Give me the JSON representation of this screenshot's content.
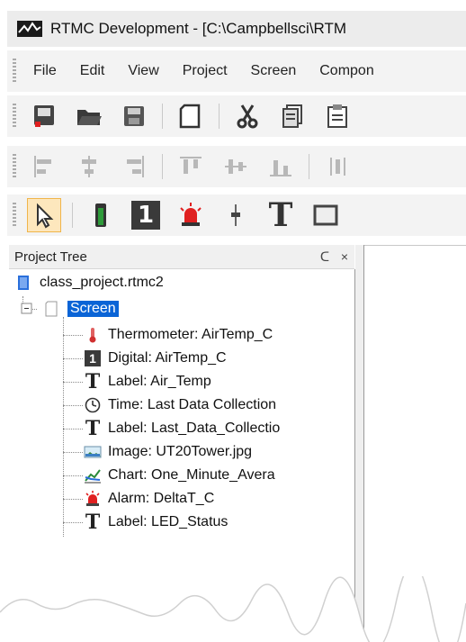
{
  "window": {
    "title": "RTMC Development - [C:\\Campbellsci\\RTM"
  },
  "menu": {
    "items": [
      "File",
      "Edit",
      "View",
      "Project",
      "Screen",
      "Compon"
    ]
  },
  "toolbar1": {
    "icons": [
      "new-document-icon",
      "open-folder-icon",
      "save-icon",
      "blank-page-icon",
      "cut-icon",
      "copy-icon",
      "paste-icon"
    ]
  },
  "toolbar2": {
    "icons": [
      "align-left-icon",
      "align-center-icon",
      "align-right-icon",
      "align-top-icon",
      "align-middle-icon",
      "align-bottom-icon",
      "distribute-icon"
    ]
  },
  "toolbar3": {
    "digit": "1",
    "t_glyph": "T",
    "icons": [
      "select-pointer-icon",
      "thermometer-icon",
      "digital-icon",
      "alarm-icon",
      "slider-icon",
      "text-label-icon",
      "frame-icon"
    ]
  },
  "project_tree": {
    "title": "Project Tree",
    "pin": "ᑕ",
    "close": "×",
    "root": "class_project.rtmc2",
    "screen": "Screen",
    "items": [
      {
        "label": "Thermometer: AirTemp_C",
        "icon": "thermometer-icon"
      },
      {
        "label": "Digital: AirTemp_C",
        "icon": "digital-icon",
        "glyph": "1"
      },
      {
        "label": "Label: Air_Temp",
        "icon": "text-label-icon",
        "glyph": "T"
      },
      {
        "label": "Time: Last Data Collection",
        "icon": "clock-icon"
      },
      {
        "label": "Label: Last_Data_Collectio",
        "icon": "text-label-icon",
        "glyph": "T"
      },
      {
        "label": "Image: UT20Tower.jpg",
        "icon": "image-icon"
      },
      {
        "label": "Chart: One_Minute_Avera",
        "icon": "chart-icon"
      },
      {
        "label": "Alarm: DeltaT_C",
        "icon": "alarm-icon"
      },
      {
        "label": "Label: LED_Status",
        "icon": "text-label-icon",
        "glyph": "T"
      }
    ]
  },
  "colors": {
    "selection": "#0a64d6",
    "alarm_red": "#e02020",
    "thermo_green": "#2e9b3a"
  }
}
